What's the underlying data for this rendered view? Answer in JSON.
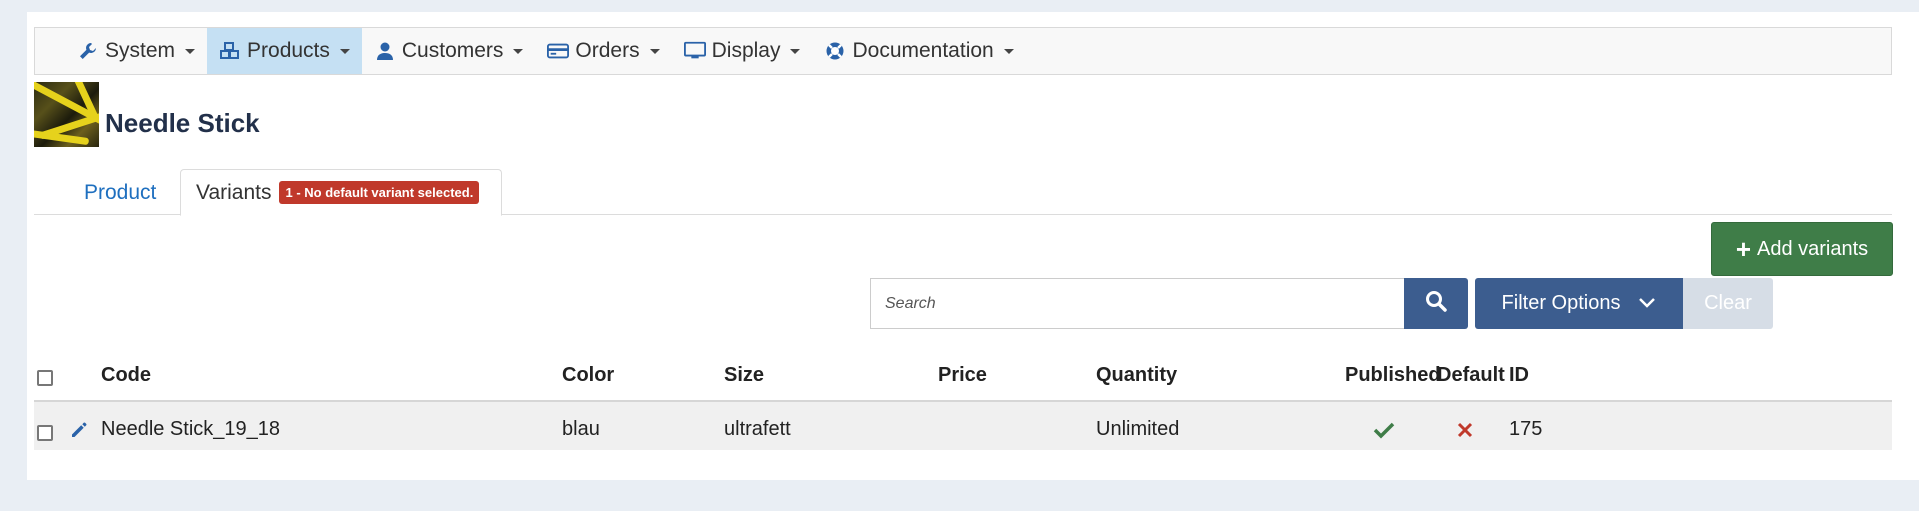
{
  "menu": [
    {
      "label": "System",
      "icon": "wrench-icon",
      "active": false
    },
    {
      "label": "Products",
      "icon": "cubes-icon",
      "active": true
    },
    {
      "label": "Customers",
      "icon": "user-icon",
      "active": false
    },
    {
      "label": "Orders",
      "icon": "credit-card-icon",
      "active": false
    },
    {
      "label": "Display",
      "icon": "monitor-icon",
      "active": false
    },
    {
      "label": "Documentation",
      "icon": "lifebuoy-icon",
      "active": false
    }
  ],
  "product": {
    "title": "Needle Stick"
  },
  "tabs": {
    "product_label": "Product",
    "variants_label": "Variants",
    "variants_badge": "1 - No default variant selected."
  },
  "toolbar": {
    "add_label": "Add variants",
    "search_placeholder": "Search",
    "filter_label": "Filter Options",
    "clear_label": "Clear"
  },
  "table": {
    "columns": {
      "code": "Code",
      "color": "Color",
      "size": "Size",
      "price": "Price",
      "quantity": "Quantity",
      "published": "Published",
      "default": "Default",
      "id": "ID"
    },
    "rows": [
      {
        "code": "Needle Stick_19_18",
        "color": "blau",
        "size": "ultrafett",
        "price": "",
        "quantity": "Unlimited",
        "published": true,
        "default": false,
        "id": "175"
      }
    ]
  },
  "colors": {
    "accent_blue": "#3c5d8f",
    "success_green": "#3f7d48",
    "danger_red": "#c0392b",
    "active_menu": "#c5e0f3"
  }
}
